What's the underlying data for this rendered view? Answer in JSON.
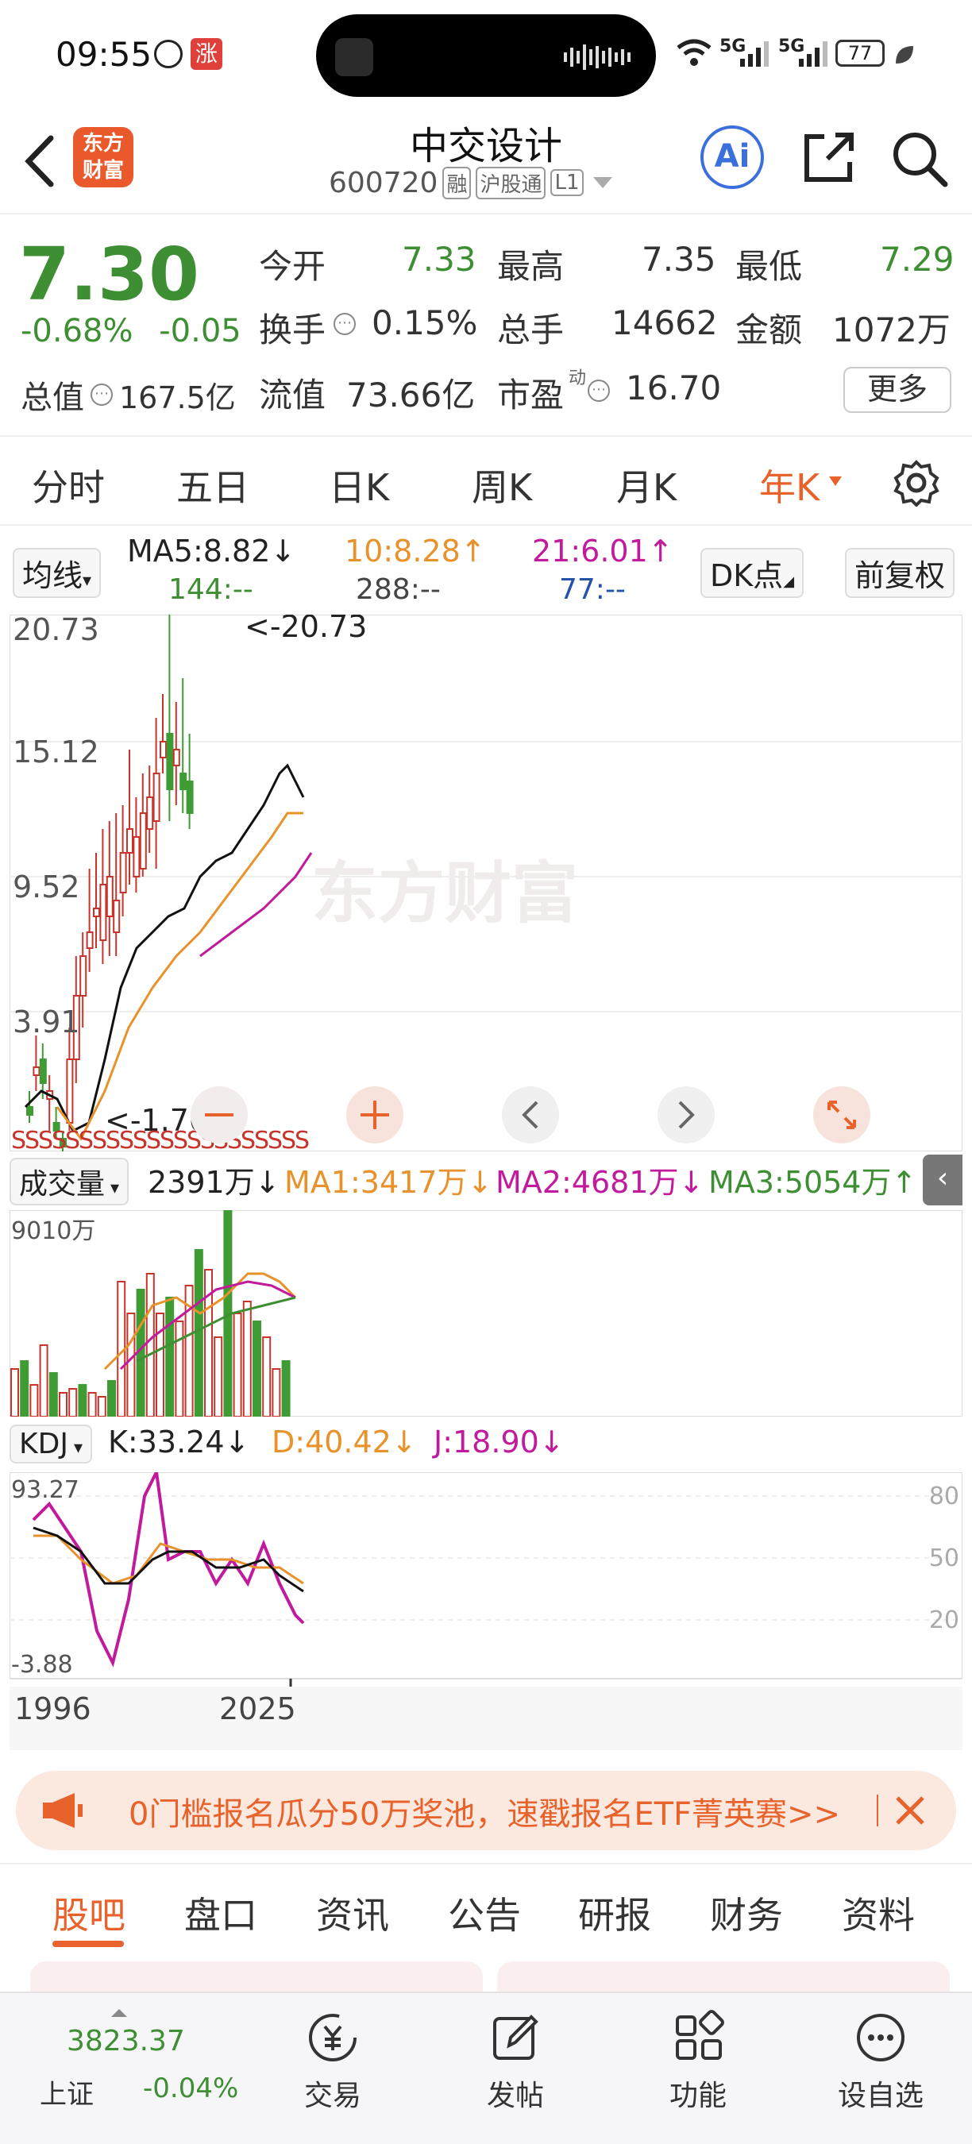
{
  "status_bar": {
    "time": "09:55",
    "badge_text": "涨",
    "network_1": "5G",
    "network_2": "5G",
    "battery": "77"
  },
  "header": {
    "logo_text_line1": "东方",
    "logo_text_line2": "财富",
    "stock_name": "中交设计",
    "stock_code": "600720",
    "tag_margin": "融",
    "tag_connect": "沪股通",
    "tag_level": "L1",
    "ai_label": "Ai"
  },
  "quote": {
    "price": "7.30",
    "change_pct": "-0.68%",
    "change_abs": "-0.05",
    "open_label": "今开",
    "open_value": "7.33",
    "high_label": "最高",
    "high_value": "7.35",
    "low_label": "最低",
    "low_value": "7.29",
    "turnover_label": "换手",
    "turnover_value": "0.15%",
    "volume_label": "总手",
    "volume_value": "14662",
    "amount_label": "金额",
    "amount_value": "1072万",
    "mktcap_label": "总值",
    "mktcap_value": "167.5亿",
    "float_label": "流值",
    "float_value": "73.66亿",
    "pe_label": "市盈",
    "pe_sup": "动",
    "pe_value": "16.70",
    "more_button": "更多"
  },
  "period_tabs": [
    "分时",
    "五日",
    "日K",
    "周K",
    "月K",
    "年K"
  ],
  "active_period": "年K",
  "ma_bar": {
    "selector": "均线",
    "ma5": "MA5:8.82↓",
    "ma10": "10:8.28↑",
    "ma21": "21:6.01↑",
    "ma144": "144:--",
    "ma288": "288:--",
    "ma77": "77:--",
    "dk_button": "DK点",
    "adjust_button": "前复权"
  },
  "kline": {
    "y_labels": [
      "20.73",
      "15.12",
      "9.52",
      "3.91"
    ],
    "max_annotation": "<-20.73",
    "min_annotation": "<-1.70",
    "watermark": "东方财富"
  },
  "volume_bar": {
    "selector": "成交量",
    "current": "2391万↓",
    "ma1": "MA1:3417万↓",
    "ma2": "MA2:4681万↓",
    "ma3": "MA3:5054万↑",
    "y_max": "9010万"
  },
  "kdj_bar": {
    "selector": "KDJ",
    "k": "K:33.24↓",
    "d": "D:40.42↓",
    "j": "J:18.90↓",
    "y_max": "93.27",
    "y_min": "-3.88",
    "right_levels": [
      "80",
      "50",
      "20"
    ]
  },
  "x_axis": {
    "start": "1996",
    "end": "2025"
  },
  "banner": {
    "text": "0门槛报名瓜分50万奖池，速戳报名ETF菁英赛>>"
  },
  "bottom_tabs": [
    "股吧",
    "盘口",
    "资讯",
    "公告",
    "研报",
    "财务",
    "资料"
  ],
  "active_bottom_tab": "股吧",
  "bottom_nav": {
    "index_value": "3823.37",
    "index_name": "上证",
    "index_change": "-0.04%",
    "items": [
      "交易",
      "发帖",
      "功能",
      "设自选"
    ]
  },
  "colors": {
    "up": "#c8332b",
    "down": "#3f9c35",
    "accent": "#e8622b",
    "ma5": "#111111",
    "ma10": "#e8922b",
    "ma21": "#c21a9c"
  }
}
